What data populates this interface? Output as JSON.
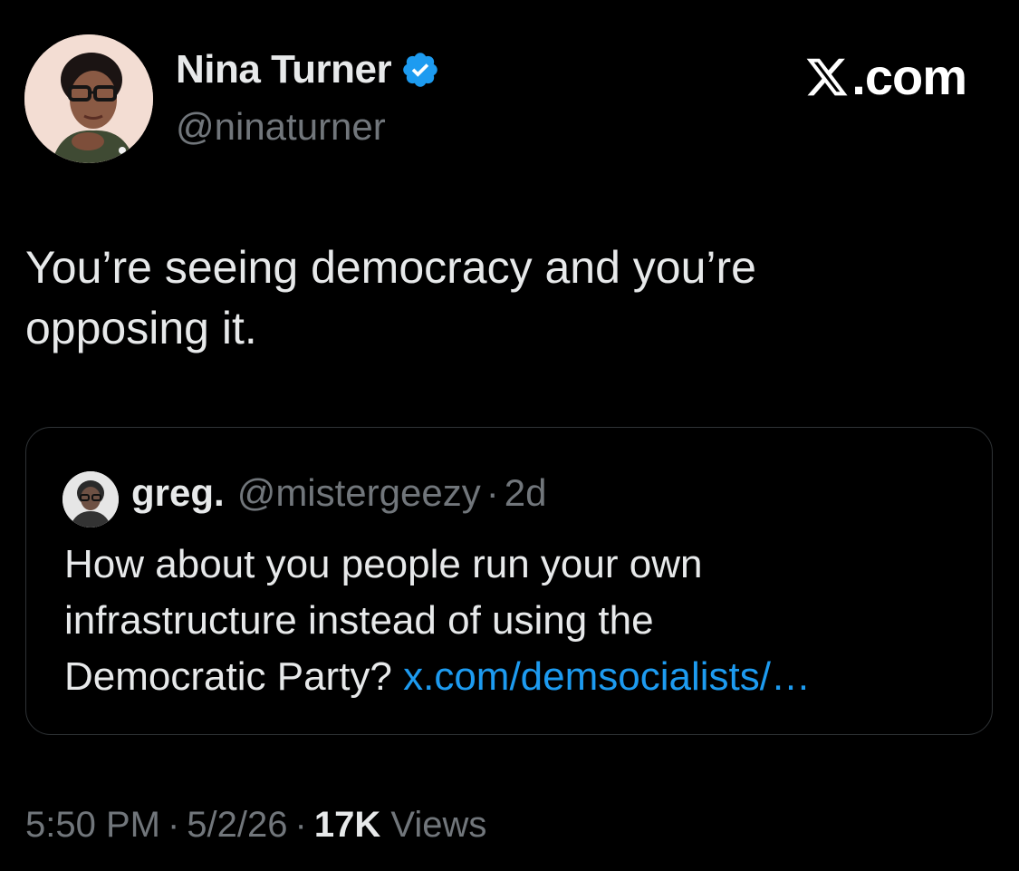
{
  "author": {
    "name": "Nina Turner",
    "handle": "@ninaturner",
    "verified": true
  },
  "brand": {
    "label": ".com"
  },
  "tweet": {
    "text_line1": "You’re seeing democracy and you’re",
    "text_line2": "opposing it."
  },
  "quoted_tweet": {
    "name": "greg.",
    "handle": "@mistergeezy",
    "separator": "·",
    "age": "2d",
    "text_line1": "How about you people run your own",
    "text_line2": "infrastructure instead of using the",
    "text_line3": "Democratic Party? ",
    "link": "x.com/demsocialists/…"
  },
  "meta": {
    "time": "5:50 PM",
    "date": "5/2/26",
    "views_count": "17K",
    "views_label": "Views",
    "separator": "·"
  },
  "colors": {
    "background": "#000000",
    "primary_text": "#e7e9ea",
    "secondary_text": "#71767b",
    "link": "#1d9bf0",
    "verified_badge": "#1d9bf0",
    "border": "#2f3336"
  },
  "icons": [
    "verified-badge-icon",
    "x-logo-icon"
  ]
}
